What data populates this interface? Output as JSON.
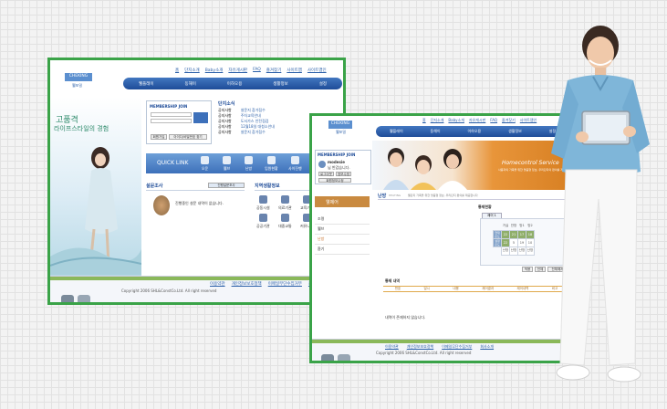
{
  "site1": {
    "top_nav": [
      "홈",
      "단지소개",
      "Baby소개",
      "자유게시판",
      "FAQ",
      "즐겨찾기",
      "사이트맵",
      "사이트맵인"
    ],
    "main_nav": [
      "웰플레이",
      "동해이",
      "이하오용",
      "생활정보",
      "설정"
    ],
    "logo": "CHEKING",
    "logo_sub": "웰포밀",
    "slogan_line1": "고품격",
    "slogan_line2": "라이프스타일의 경험",
    "membership": "MEMBERSHIP JOIN",
    "btn_join": "회원가입",
    "btn_find": "아이디/비밀번호 찾기",
    "notice_title": "단지소식",
    "notices": [
      {
        "cat": "공지사항",
        "title": "설문지 참가접수"
      },
      {
        "cat": "공지사항",
        "title": "주차교육안내"
      },
      {
        "cat": "공지사항",
        "title": "도서가스 안전점검"
      },
      {
        "cat": "공지사항",
        "title": "12월18일 대청소안내"
      },
      {
        "cat": "공지사항",
        "title": "설문지 참가접수"
      }
    ],
    "quick_link": "QUICK LINK",
    "quick_items": [
      "오운",
      "웰브",
      "난방",
      "입원현황",
      "사이진행"
    ],
    "survey_title": "설문조사",
    "survey_more": "진행설문조사",
    "survey_empty": "진행중인 설문 내역이 없습니다.",
    "info_title": "지역생활정보",
    "info_items": [
      "공동시설",
      "의료기관",
      "교육기관",
      "공공기관",
      "대중교통",
      "커뮤니티"
    ],
    "footer_links": [
      "이용약관",
      "개인정보보호정책",
      "이메일무단수집거부",
      "회사소개"
    ],
    "copyright": "Copyright 2006 SHL&ConstCo.Ltd. All right reserved"
  },
  "site2": {
    "top_nav": [
      "홈",
      "단지소개",
      "Baby소개",
      "자유게시판",
      "FAQ",
      "즐겨찾기",
      "사이트맵인"
    ],
    "main_nav": [
      "웰플레이",
      "동해이",
      "이하오용",
      "생활정보",
      "설정"
    ],
    "logo": "CHEKING",
    "logo_sub": "웰포밀",
    "member_label": "MEMBERSHIP JOIN",
    "welcome_user": "modesie",
    "welcome_text": "님 반갑습니다.",
    "btn_logout": "로그아웃",
    "btn_info": "정보수정",
    "btn_setting": "회원정보수정",
    "banner_title": "Homecontrol Service",
    "banner_text": "사용자의 가족을 위한 맞춤형 정보, 우리단지의 편의를 제공합니다",
    "side_title": "웰제어",
    "side_items": [
      "조명",
      "웰브",
      "난방",
      "환기"
    ],
    "page_title": "난방",
    "page_sub": "HEATING",
    "page_desc": "웰단지 가족을 위한 맞춤형 정보, 우리단지 편의를 제공합니다",
    "status_title": "통제현황",
    "status_tab": "제어 1",
    "cal_header": [
      "거실",
      "안방",
      "방1",
      "방2"
    ],
    "cal_rows": [
      [
        "22",
        "21",
        "17",
        "18"
      ],
      [
        "22",
        "5",
        "19",
        "10"
      ]
    ],
    "cal_row_labels": [
      "현재온도",
      "설정온도"
    ],
    "cal_foot": [
      "난방",
      "난방",
      "난방",
      "난방"
    ],
    "btn_apply": "적용",
    "btn_all": "전체",
    "btn_cancel": "전체해제",
    "history_title": "통제 내역",
    "history_cols": [
      "번호",
      "일시",
      "내용",
      "제어결과",
      "제어내역",
      "비고"
    ],
    "history_empty": "내역이 존재하지 않습니다.",
    "footer_links": [
      "이용약관",
      "개인정보보호정책",
      "이메일무단수집거부",
      "회사소개"
    ],
    "copyright": "Copyright 2006 SHL&ConstCo.Ltd. All right reserved"
  },
  "colors": {
    "frame": "#3aa348",
    "nav": "#2a5fa8",
    "banner": "#e8953a",
    "accent": "#8fae6a"
  }
}
